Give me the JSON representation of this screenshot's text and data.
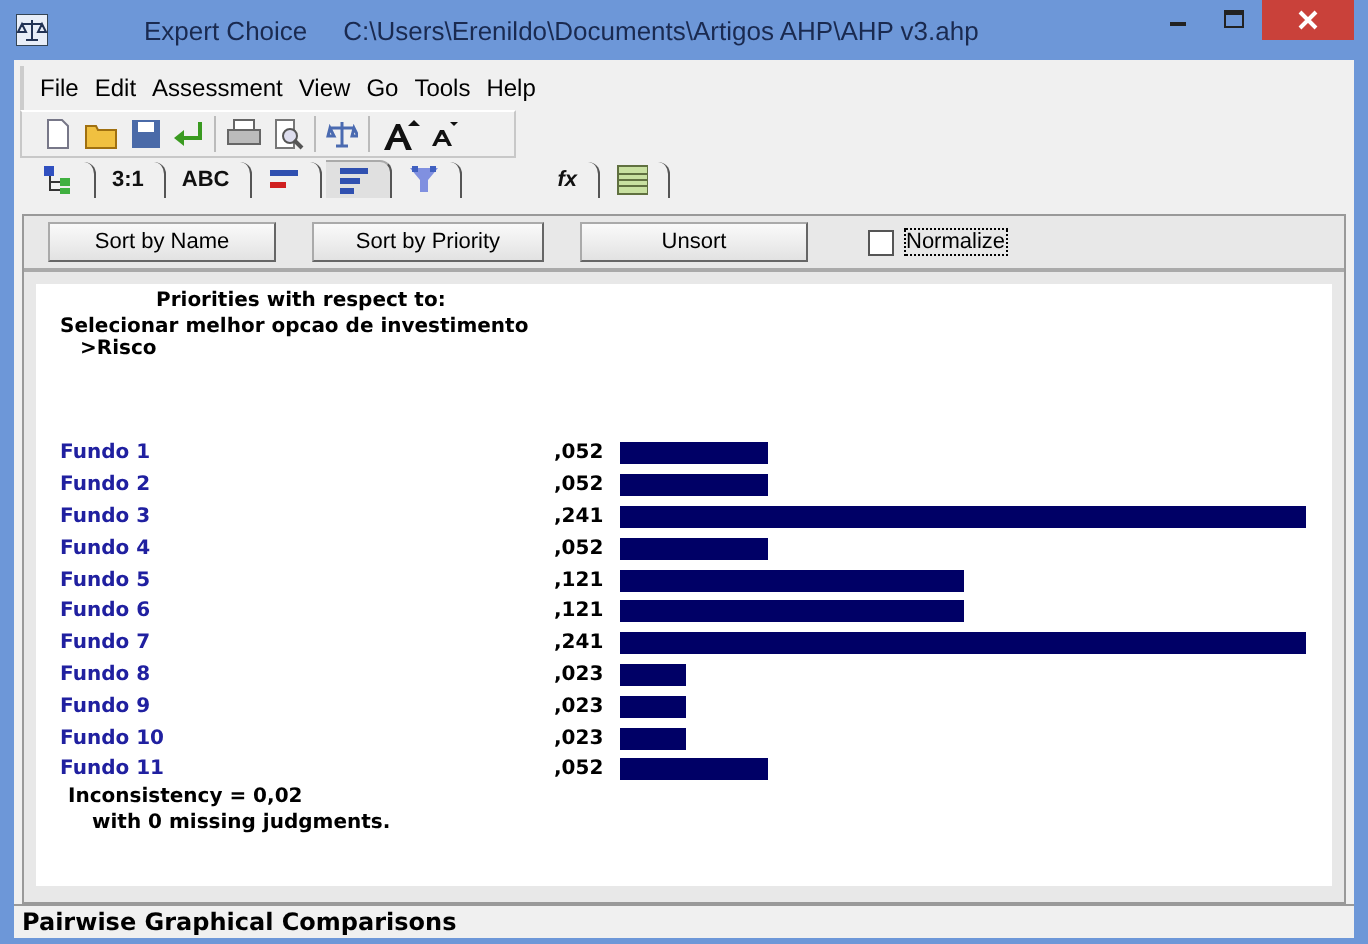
{
  "window": {
    "title": "Expert Choice",
    "path": "C:\\Users\\Erenildo\\Documents\\Artigos AHP\\AHP v3.ahp"
  },
  "menu": [
    "File",
    "Edit",
    "Assessment",
    "View",
    "Go",
    "Tools",
    "Help"
  ],
  "tabs": [
    {
      "kind": "tree",
      "selected": false
    },
    {
      "kind": "text",
      "label": "3:1",
      "selected": false
    },
    {
      "kind": "text",
      "label": "ABC",
      "selected": false
    },
    {
      "kind": "bars-red",
      "selected": false
    },
    {
      "kind": "bars",
      "selected": true
    },
    {
      "kind": "funnel",
      "selected": false
    },
    {
      "kind": "text",
      "label": "fx",
      "selected": false
    },
    {
      "kind": "grid",
      "selected": false
    }
  ],
  "sort_buttons": [
    "Sort by Name",
    "Sort by Priority",
    "Unsort"
  ],
  "normalize": {
    "label": "Normalize",
    "checked": false
  },
  "heading": "Priorities with respect to:",
  "goal": "Selecionar melhor opcao de investimento",
  "node": ">Risco",
  "items": [
    {
      "name": "Fundo 1",
      "value": ",052"
    },
    {
      "name": "Fundo 2",
      "value": ",052"
    },
    {
      "name": "Fundo 3",
      "value": ",241"
    },
    {
      "name": "Fundo 4",
      "value": ",052"
    },
    {
      "name": "Fundo 5",
      "value": ",121"
    },
    {
      "name": "Fundo 6",
      "value": ",121"
    },
    {
      "name": "Fundo 7",
      "value": ",241"
    },
    {
      "name": "Fundo 8",
      "value": ",023"
    },
    {
      "name": "Fundo 9",
      "value": ",023"
    },
    {
      "name": "Fundo 10",
      "value": ",023"
    },
    {
      "name": "Fundo 11",
      "value": ",052"
    }
  ],
  "inconsistency": "Inconsistency = 0,02",
  "missing": "with 0  missing judgments.",
  "status_bar": "Pairwise Graphical Comparisons"
}
